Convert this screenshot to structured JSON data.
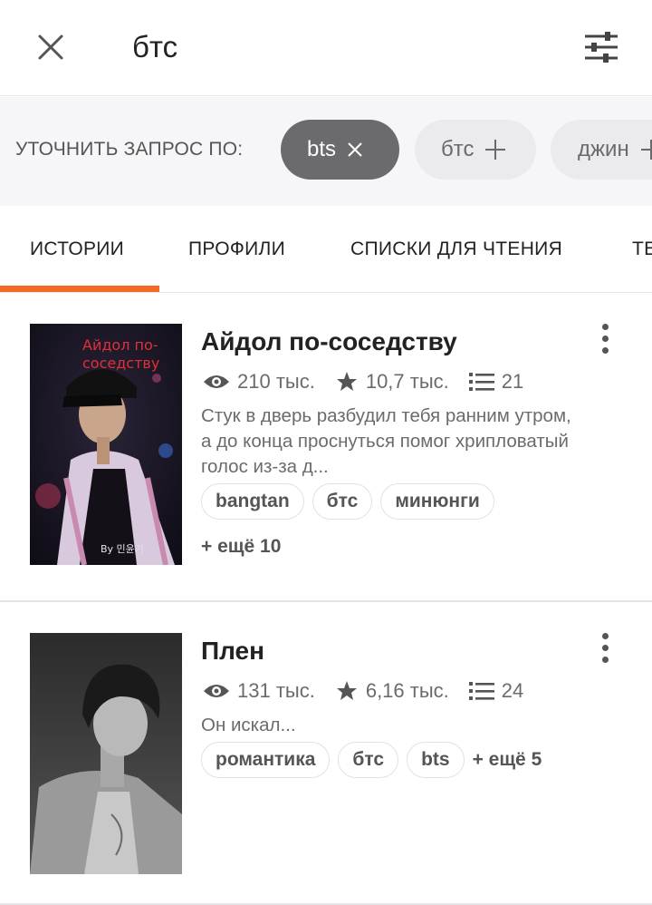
{
  "search": {
    "query": "бтс"
  },
  "refine": {
    "label": "УТОЧНИТЬ ЗАПРОС ПО:",
    "chips": [
      {
        "label": "bts",
        "active": true,
        "symbol": "×"
      },
      {
        "label": "бтс",
        "active": false,
        "symbol": "+"
      },
      {
        "label": "джин",
        "active": false,
        "symbol": "+"
      }
    ]
  },
  "tabs": [
    {
      "label": "ИСТОРИИ",
      "active": true
    },
    {
      "label": "ПРОФИЛИ"
    },
    {
      "label": "СПИСКИ ДЛЯ ЧТЕНИЯ"
    },
    {
      "label": "ТЕГИ"
    }
  ],
  "stories": [
    {
      "title": "Айдол по-соседству",
      "reads": "210 тыс.",
      "votes": "10,7 тыс.",
      "parts": "21",
      "description": "Стук в дверь разбудил тебя ранним утром, а до конца проснуться помог хрипловатый голос из-за д...",
      "tags": [
        "bangtan",
        "бтс",
        "минюнги"
      ],
      "more_tags": "+ ещё 10",
      "cover_text": "Айдол по-соседству",
      "cover_signature": "By 민윤기"
    },
    {
      "title": "Плен",
      "reads": "131 тыс.",
      "votes": "6,16 тыс.",
      "parts": "24",
      "description": "Он искал...",
      "tags": [
        "романтика",
        "бтс",
        "bts"
      ],
      "more_tags": "+ ещё 5"
    }
  ],
  "colors": {
    "accent": "#f36a24",
    "active_chip": "#6b6a6d",
    "inactive_chip": "#ebeaed"
  }
}
